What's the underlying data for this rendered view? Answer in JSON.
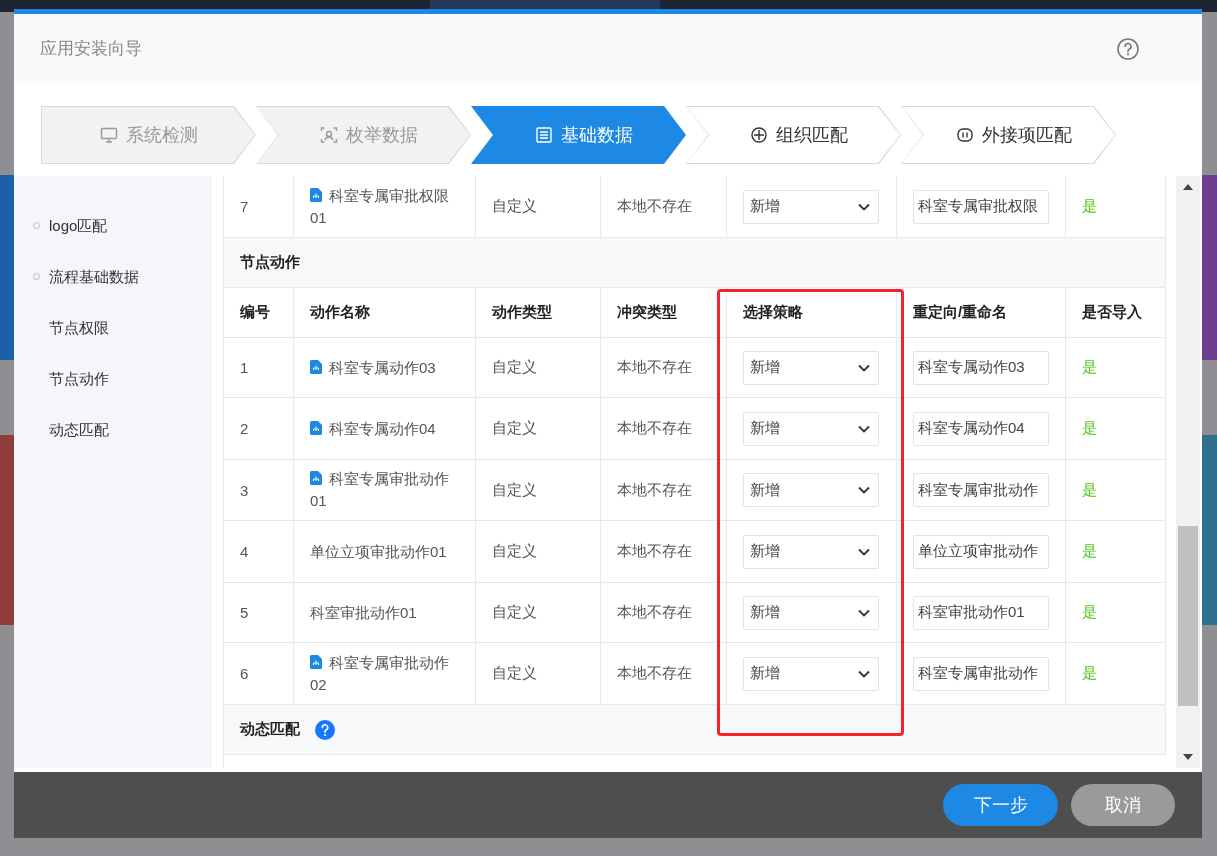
{
  "dialog": {
    "title": "应用安装向导"
  },
  "steps": [
    {
      "label": "系统检测",
      "selected": false,
      "completed": true
    },
    {
      "label": "枚举数据",
      "selected": false,
      "completed": true
    },
    {
      "label": "基础数据",
      "selected": true,
      "completed": false
    },
    {
      "label": "组织匹配",
      "selected": false,
      "completed": false
    },
    {
      "label": "外接项匹配",
      "selected": false,
      "completed": false
    }
  ],
  "sidebar": {
    "items": [
      {
        "label": "logo匹配"
      },
      {
        "label": "流程基础数据",
        "children": [
          {
            "label": "节点权限"
          },
          {
            "label": "节点动作"
          },
          {
            "label": "动态匹配"
          }
        ]
      }
    ]
  },
  "sections": [
    {
      "rows": [
        {
          "number": "7",
          "name": "科室专属审批权限01",
          "icon": true,
          "action_type": "自定义",
          "conflict": "本地不存在",
          "strategy": "新增",
          "rename": "科室专属审批权限",
          "import": "是"
        }
      ]
    },
    {
      "title": "节点动作",
      "columns": [
        "编号",
        "动作名称",
        "动作类型",
        "冲突类型",
        "选择策略",
        "重定向/重命名",
        "是否导入"
      ],
      "rows": [
        {
          "number": "1",
          "name": "科室专属动作03",
          "icon": true,
          "action_type": "自定义",
          "conflict": "本地不存在",
          "strategy": "新增",
          "rename": "科室专属动作03",
          "import": "是"
        },
        {
          "number": "2",
          "name": "科室专属动作04",
          "icon": true,
          "action_type": "自定义",
          "conflict": "本地不存在",
          "strategy": "新增",
          "rename": "科室专属动作04",
          "import": "是"
        },
        {
          "number": "3",
          "name": "科室专属审批动作01",
          "icon": true,
          "action_type": "自定义",
          "conflict": "本地不存在",
          "strategy": "新增",
          "rename": "科室专属审批动作",
          "import": "是"
        },
        {
          "number": "4",
          "name": "单位立项审批动作01",
          "icon": false,
          "action_type": "自定义",
          "conflict": "本地不存在",
          "strategy": "新增",
          "rename": "单位立项审批动作",
          "import": "是"
        },
        {
          "number": "5",
          "name": "科室审批动作01",
          "icon": false,
          "action_type": "自定义",
          "conflict": "本地不存在",
          "strategy": "新增",
          "rename": "科室审批动作01",
          "import": "是"
        },
        {
          "number": "6",
          "name": "科室专属审批动作02",
          "icon": true,
          "action_type": "自定义",
          "conflict": "本地不存在",
          "strategy": "新增",
          "rename": "科室专属审批动作",
          "import": "是"
        }
      ]
    },
    {
      "title": "动态匹配",
      "help": true
    }
  ],
  "footer": {
    "buttons": [
      {
        "label": "下一步",
        "kind": "primary"
      },
      {
        "label": "取消",
        "kind": "secondary"
      }
    ]
  }
}
